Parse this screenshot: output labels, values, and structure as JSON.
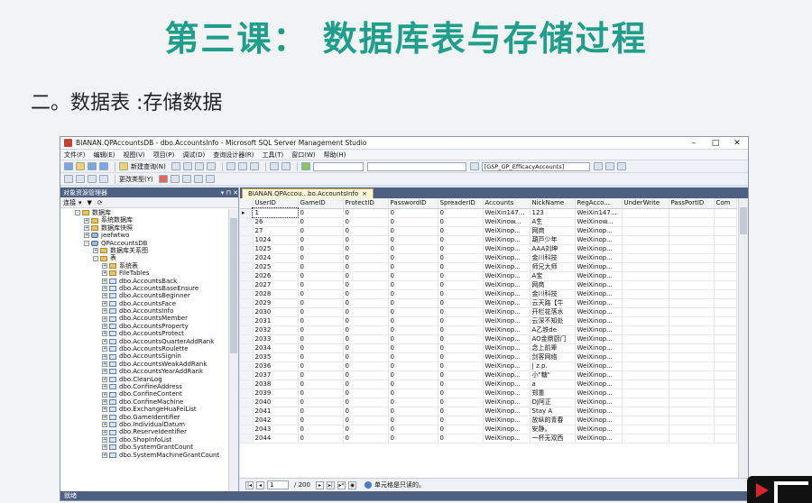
{
  "slide": {
    "title": "第三课：   数据库表与存储过程",
    "subtitle": "二。数据表   :存储数据"
  },
  "window": {
    "title": "BIANAN.QPAccountsDB - dbo.AccountsInfo - Microsoft SQL Server Management Studio",
    "menu": [
      "文件(F)",
      "编辑(E)",
      "视图(V)",
      "项目(P)",
      "调试(D)",
      "查询设计器(R)",
      "工具(T)",
      "窗口(W)",
      "帮助(H)"
    ],
    "toolbar": {
      "new_query": "新建查询(N)",
      "change_type": "更改类型(Y)",
      "db_combo": "[GSP_GP_EfficacyAccounts]"
    }
  },
  "explorer": {
    "title": "对象资源管理器",
    "connect": "连接",
    "tree": [
      {
        "label": "数据库",
        "level": 0,
        "kind": "folder",
        "expand": "-"
      },
      {
        "label": "系统数据库",
        "level": 1,
        "kind": "folder",
        "expand": "+"
      },
      {
        "label": "数据库快照",
        "level": 1,
        "kind": "folder",
        "expand": "+"
      },
      {
        "label": "jeefwtwo",
        "level": 1,
        "kind": "db",
        "expand": "+"
      },
      {
        "label": "QPAccountsDB",
        "level": 1,
        "kind": "db",
        "expand": "-"
      },
      {
        "label": "数据库关系图",
        "level": 2,
        "kind": "folder",
        "expand": "+"
      },
      {
        "label": "表",
        "level": 2,
        "kind": "folder",
        "expand": "-"
      },
      {
        "label": "系统表",
        "level": 3,
        "kind": "folder",
        "expand": "+"
      },
      {
        "label": "FileTables",
        "level": 3,
        "kind": "folder",
        "expand": "+"
      },
      {
        "label": "dbo.AccountsBack",
        "level": 3,
        "kind": "tbl",
        "expand": "+"
      },
      {
        "label": "dbo.AccountsBaseEnsure",
        "level": 3,
        "kind": "tbl",
        "expand": "+"
      },
      {
        "label": "dbo.AccountsBeginner",
        "level": 3,
        "kind": "tbl",
        "expand": "+"
      },
      {
        "label": "dbo.AccountsFace",
        "level": 3,
        "kind": "tbl",
        "expand": "+"
      },
      {
        "label": "dbo.AccountsInfo",
        "level": 3,
        "kind": "tbl",
        "expand": "+"
      },
      {
        "label": "dbo.AccountsMember",
        "level": 3,
        "kind": "tbl",
        "expand": "+"
      },
      {
        "label": "dbo.AccountsProperty",
        "level": 3,
        "kind": "tbl",
        "expand": "+"
      },
      {
        "label": "dbo.AccountsProtect",
        "level": 3,
        "kind": "tbl",
        "expand": "+"
      },
      {
        "label": "dbo.AccountsQuarterAddRank",
        "level": 3,
        "kind": "tbl",
        "expand": "+"
      },
      {
        "label": "dbo.AccountsRoulette",
        "level": 3,
        "kind": "tbl",
        "expand": "+"
      },
      {
        "label": "dbo.AccountsSignin",
        "level": 3,
        "kind": "tbl",
        "expand": "+"
      },
      {
        "label": "dbo.AccountsWeakAddRank",
        "level": 3,
        "kind": "tbl",
        "expand": "+"
      },
      {
        "label": "dbo.AccountsYearAddRank",
        "level": 3,
        "kind": "tbl",
        "expand": "+"
      },
      {
        "label": "dbo.CleanLog",
        "level": 3,
        "kind": "tbl",
        "expand": "+"
      },
      {
        "label": "dbo.ConfineAddress",
        "level": 3,
        "kind": "tbl",
        "expand": "+"
      },
      {
        "label": "dbo.ConfineContent",
        "level": 3,
        "kind": "tbl",
        "expand": "+"
      },
      {
        "label": "dbo.ConfineMachine",
        "level": 3,
        "kind": "tbl",
        "expand": "+"
      },
      {
        "label": "dbo.ExchangeHuaFeiList",
        "level": 3,
        "kind": "tbl",
        "expand": "+"
      },
      {
        "label": "dbo.GameIdentifier",
        "level": 3,
        "kind": "tbl",
        "expand": "+"
      },
      {
        "label": "dbo.IndividualDatum",
        "level": 3,
        "kind": "tbl",
        "expand": "+"
      },
      {
        "label": "dbo.ReserveIdentifier",
        "level": 3,
        "kind": "tbl",
        "expand": "+"
      },
      {
        "label": "dbo.ShopInfoList",
        "level": 3,
        "kind": "tbl",
        "expand": "+"
      },
      {
        "label": "dbo.SystemGrantCount",
        "level": 3,
        "kind": "tbl",
        "expand": "+"
      },
      {
        "label": "dbo.SystemMachineGrantCount",
        "level": 3,
        "kind": "tbl",
        "expand": "+"
      }
    ]
  },
  "tab": {
    "label": "BIANAN.QPAccou...bo.AccountsInfo",
    "close": "×"
  },
  "grid": {
    "columns": [
      "UserID",
      "GameID",
      "ProtectID",
      "PasswordID",
      "SpreaderID",
      "Accounts",
      "NickName",
      "RegAcco...",
      "UnderWrite",
      "PassPortID",
      "Com"
    ],
    "rows": [
      [
        "1",
        "0",
        "0",
        "0",
        "0",
        "WeiXin147...",
        "123",
        "WeiXin147..."
      ],
      [
        "26",
        "0",
        "0",
        "0",
        "0",
        "WeiXinow...",
        "A生",
        "WeiXinow..."
      ],
      [
        "27",
        "0",
        "0",
        "0",
        "0",
        "WeiXinop...",
        "网商",
        "WeiXinop..."
      ],
      [
        "1024",
        "0",
        "0",
        "0",
        "0",
        "WeiXinop...",
        "葫芦少年",
        "WeiXinop..."
      ],
      [
        "1025",
        "0",
        "0",
        "0",
        "0",
        "WeiXinop...",
        "AAA刘坤",
        "WeiXinop..."
      ],
      [
        "2024",
        "0",
        "0",
        "0",
        "0",
        "WeiXinop...",
        "金川科技",
        "WeiXinop..."
      ],
      [
        "2025",
        "0",
        "0",
        "0",
        "0",
        "WeiXinop...",
        "师兄大师",
        "WeiXinop..."
      ],
      [
        "2026",
        "0",
        "0",
        "0",
        "0",
        "WeiXinop...",
        "A宝",
        "WeiXinop..."
      ],
      [
        "2027",
        "0",
        "0",
        "0",
        "0",
        "WeiXinop...",
        "网商",
        "WeiXinop..."
      ],
      [
        "2028",
        "0",
        "0",
        "0",
        "0",
        "WeiXinop...",
        "金川科技",
        "WeiXinop..."
      ],
      [
        "2029",
        "0",
        "0",
        "0",
        "0",
        "WeiXinop...",
        "云天路【牛",
        "WeiXinop..."
      ],
      [
        "2030",
        "0",
        "0",
        "0",
        "0",
        "WeiXinop...",
        "开栏花落水",
        "WeiXinop..."
      ],
      [
        "2031",
        "0",
        "0",
        "0",
        "0",
        "WeiXinop...",
        "云深不知处",
        "WeiXinop..."
      ],
      [
        "2032",
        "0",
        "0",
        "0",
        "0",
        "WeiXinop...",
        "A乙铁de",
        "WeiXinop..."
      ],
      [
        "2033",
        "0",
        "0",
        "0",
        "0",
        "WeiXinop...",
        "AO金鼎厨门",
        "WeiXinop..."
      ],
      [
        "2034",
        "0",
        "0",
        "0",
        "0",
        "WeiXinop...",
        "念上前辈",
        "WeiXinop..."
      ],
      [
        "2035",
        "0",
        "0",
        "0",
        "0",
        "WeiXinop...",
        "剑客网络",
        "WeiXinop..."
      ],
      [
        "2036",
        "0",
        "0",
        "0",
        "0",
        "WeiXinop...",
        "| z.p.",
        "WeiXinop..."
      ],
      [
        "2037",
        "0",
        "0",
        "0",
        "0",
        "WeiXinop...",
        "小\"糖\"",
        "WeiXinop..."
      ],
      [
        "2038",
        "0",
        "0",
        "0",
        "0",
        "WeiXinop...",
        "a",
        "WeiXinop..."
      ],
      [
        "2039",
        "0",
        "0",
        "0",
        "0",
        "WeiXinop...",
        "郑重",
        "WeiXinop..."
      ],
      [
        "2040",
        "0",
        "0",
        "0",
        "0",
        "WeiXinop...",
        "DJ阿正",
        "WeiXinop..."
      ],
      [
        "2041",
        "0",
        "0",
        "0",
        "0",
        "WeiXinop...",
        "Stay A",
        "WeiXinop..."
      ],
      [
        "2042",
        "0",
        "0",
        "0",
        "0",
        "WeiXinop...",
        "放纵的青春",
        "WeiXinop..."
      ],
      [
        "2043",
        "0",
        "0",
        "0",
        "0",
        "WeiXinop...",
        "安静。",
        "WeiXinop..."
      ],
      [
        "2044",
        "0",
        "0",
        "0",
        "0",
        "WeiXinop...",
        "一杯无双西",
        "WeiXinop..."
      ]
    ]
  },
  "navbar": {
    "position": "1",
    "count": "/ 200",
    "message": "单元格是只读的。"
  },
  "statusbar": {
    "text": "就绪"
  }
}
